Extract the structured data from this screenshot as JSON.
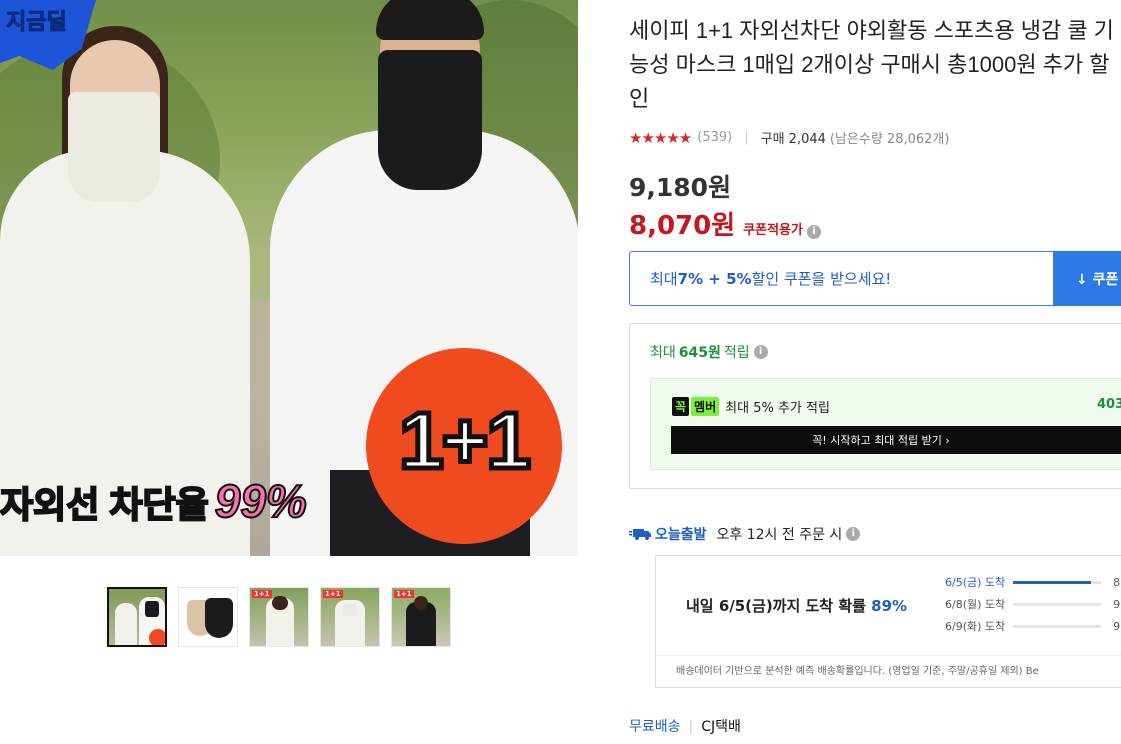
{
  "hero": {
    "logo_text": "지금딜",
    "promo_badge": "1+1",
    "uv_caption": "자외선 차단율",
    "uv_percent": "99%"
  },
  "thumbnails": [
    {
      "name": "thumb-1",
      "selected": true,
      "tag": ""
    },
    {
      "name": "thumb-2",
      "selected": false,
      "tag": ""
    },
    {
      "name": "thumb-3",
      "selected": false,
      "tag": "1+1"
    },
    {
      "name": "thumb-4",
      "selected": false,
      "tag": "1+1"
    },
    {
      "name": "thumb-5",
      "selected": false,
      "tag": "1+1"
    }
  ],
  "product": {
    "title": "세이피 1+1 자외선차단 야외활동 스포츠용 냉감 쿨 기능성 마스크 1매입 2개이상 구매시 총1000원 추가 할인",
    "stars": "★★★★★",
    "rating_value": 4.5,
    "review_count": "(539)",
    "purchase": "구매 2,044",
    "remaining": "(남은수량 28,062개)",
    "original_price": "9,180원",
    "sale_price": "8,070원",
    "coupon_applied": "쿠폰적용가"
  },
  "coupon": {
    "prefix": "최대 ",
    "highlight": "7% + 5%",
    "suffix": " 할인 쿠폰을 받으세요!",
    "button": "↓ 쿠폰"
  },
  "reward": {
    "prefix": "최대",
    "amount": "645원",
    "suffix": "적립",
    "member_badge_a": "꼭",
    "member_badge_b": "멤버",
    "member_text": "최대 5% 추가 적립",
    "member_amount": "403",
    "member_button": "꼭! 시작하고 최대 적립 받기 ›"
  },
  "shipping": {
    "today_label": "오늘출발",
    "note": "오후 12시 전 주문 시",
    "arrival_prefix": "내일 6/5(금)까지 도착 확률",
    "arrival_pct": "89%",
    "bars": [
      {
        "label": "6/5(금) 도착",
        "fraction": 0.89,
        "value": "8"
      },
      {
        "label": "6/8(월) 도착",
        "fraction": 0.0,
        "value": "9"
      },
      {
        "label": "6/9(화) 도착",
        "fraction": 0.0,
        "value": "9"
      }
    ],
    "footnote": "배송데이터 기반으로 분석한 예측 배송확률입니다. (영업일 기준, 주말/공휴일 제외) Be",
    "free_shipping": "무료배송",
    "carrier": "CJ택배"
  },
  "colors": {
    "sale_red": "#c4161c",
    "link_blue": "#1e5fc0",
    "reward_green": "#1e8f39",
    "badge_orange": "#f04a1f"
  }
}
